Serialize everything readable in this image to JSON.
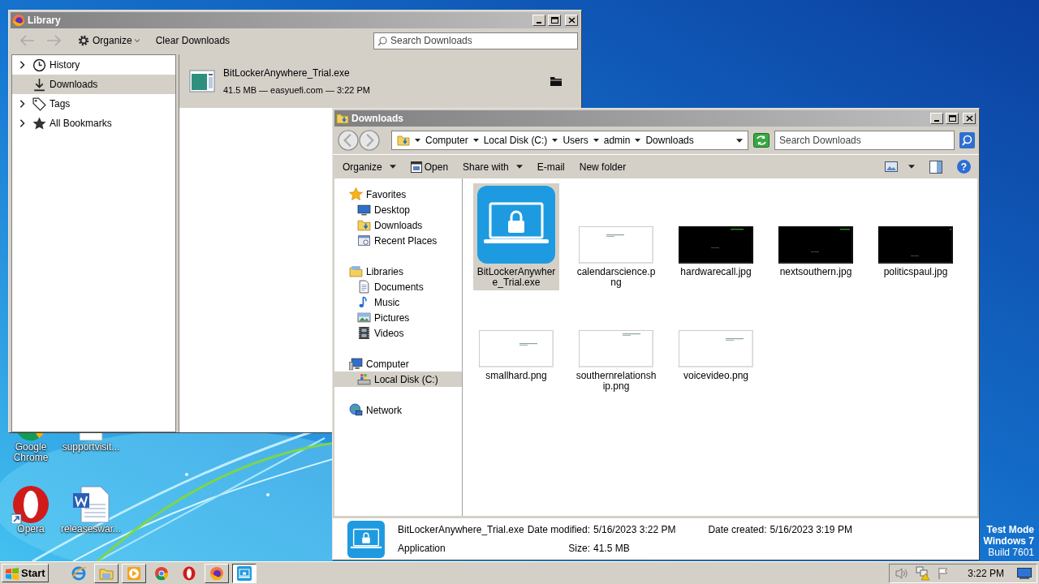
{
  "desktop": {
    "icons": [
      {
        "label": "Google Chrome",
        "kind": "chrome"
      },
      {
        "label": "supportvisit...",
        "kind": "document"
      },
      {
        "label": "Opera",
        "kind": "opera"
      },
      {
        "label": "releaseswar...",
        "kind": "word"
      }
    ],
    "notice": [
      "Test Mode",
      "Windows 7",
      "Build 7601"
    ]
  },
  "library": {
    "title": "Library",
    "organize": "Organize",
    "clear_downloads": "Clear Downloads",
    "search_placeholder": "Search Downloads",
    "sidebar": [
      {
        "label": "History",
        "kind": "history",
        "expandable": true,
        "selected": false
      },
      {
        "label": "Downloads",
        "kind": "downloads",
        "expandable": false,
        "selected": true
      },
      {
        "label": "Tags",
        "kind": "tags",
        "expandable": true,
        "selected": false
      },
      {
        "label": "All Bookmarks",
        "kind": "bookmarks",
        "expandable": true,
        "selected": false
      }
    ],
    "downloads": [
      {
        "name": "BitLockerAnywhere_Trial.exe",
        "details": "41.5 MB — easyuefi.com — 3:22 PM",
        "selected": true
      }
    ]
  },
  "explorer": {
    "title": "Downloads",
    "path": [
      "Computer",
      "Local Disk (C:)",
      "Users",
      "admin",
      "Downloads"
    ],
    "search_placeholder": "Search Downloads",
    "help": "?",
    "commands": [
      {
        "label": "Organize",
        "kind": "menu"
      },
      {
        "label": "Open",
        "kind": "open"
      },
      {
        "label": "Share with",
        "kind": "menu"
      },
      {
        "label": "E-mail",
        "kind": "plain"
      },
      {
        "label": "New folder",
        "kind": "plain"
      }
    ],
    "nav": [
      {
        "label": "Favorites",
        "kind": "favorites",
        "selected": false,
        "children": [
          {
            "label": "Desktop",
            "kind": "desktop",
            "selected": false
          },
          {
            "label": "Downloads",
            "kind": "folder",
            "selected": false
          },
          {
            "label": "Recent Places",
            "kind": "recent",
            "selected": false
          }
        ]
      },
      {
        "label": "Libraries",
        "kind": "libraries",
        "selected": false,
        "children": [
          {
            "label": "Documents",
            "kind": "documents",
            "selected": false
          },
          {
            "label": "Music",
            "kind": "music",
            "selected": false
          },
          {
            "label": "Pictures",
            "kind": "pictures",
            "selected": false
          },
          {
            "label": "Videos",
            "kind": "videos",
            "selected": false
          }
        ]
      },
      {
        "label": "Computer",
        "kind": "computer",
        "selected": false,
        "children": [
          {
            "label": "Local Disk (C:)",
            "kind": "disk",
            "selected": true
          }
        ]
      },
      {
        "label": "Network",
        "kind": "network",
        "selected": false
      }
    ],
    "files": [
      {
        "name": "BitLockerAnywhere_Trial.exe",
        "kind": "app",
        "selected": true
      },
      {
        "name": "calendarscience.png",
        "kind": "light",
        "selected": false
      },
      {
        "name": "hardwarecall.jpg",
        "kind": "dark",
        "selected": false
      },
      {
        "name": "nextsouthern.jpg",
        "kind": "dark",
        "selected": false
      },
      {
        "name": "politicspaul.jpg",
        "kind": "dark",
        "selected": false
      },
      {
        "name": "smallhard.png",
        "kind": "light",
        "selected": false
      },
      {
        "name": "southernrelationship.png",
        "kind": "light",
        "selected": false
      },
      {
        "name": "voicevideo.png",
        "kind": "light",
        "selected": false
      }
    ],
    "details": {
      "name": "BitLockerAnywhere_Trial.exe",
      "type": "Application",
      "fields": [
        {
          "label": "Date modified:",
          "value": "5/16/2023 3:22 PM"
        },
        {
          "label": "Size:",
          "value": "41.5 MB"
        },
        {
          "label": "Date created:",
          "value": "5/16/2023 3:19 PM"
        }
      ]
    }
  },
  "taskbar": {
    "start": "Start",
    "clock": "3:22 PM",
    "apps": [
      {
        "kind": "ie",
        "running": false,
        "selected": false
      },
      {
        "kind": "folder",
        "running": true,
        "selected": false
      },
      {
        "kind": "media",
        "running": true,
        "selected": false
      },
      {
        "kind": "chrome",
        "running": false,
        "selected": false
      },
      {
        "kind": "opera",
        "running": false,
        "selected": false
      },
      {
        "kind": "firefox",
        "running": true,
        "selected": false
      },
      {
        "kind": "app",
        "running": true,
        "selected": true
      }
    ]
  }
}
